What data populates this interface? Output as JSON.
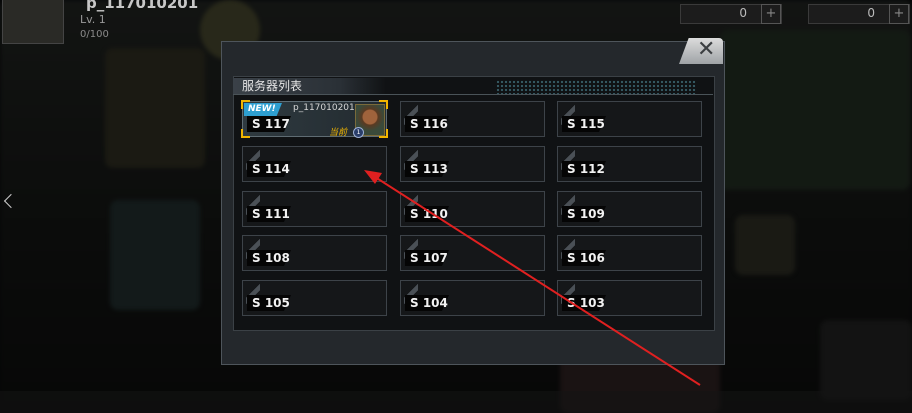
{
  "player": {
    "name": "p_117010201",
    "level_text": "Lv. 1",
    "exp_text": "0/100"
  },
  "currency": [
    {
      "icon": "gem-icon",
      "value": "0"
    },
    {
      "icon": "gold-icon",
      "value": "0"
    }
  ],
  "dialog": {
    "title": "服务器列表",
    "close_icon": "close-icon"
  },
  "current_server": {
    "label": "S 117",
    "badge": "NEW!",
    "player_name": "p_117010201",
    "current_tag": "当前",
    "rank": "1"
  },
  "servers": [
    {
      "label": "S 116"
    },
    {
      "label": "S 115"
    },
    {
      "label": "S 114"
    },
    {
      "label": "S 113"
    },
    {
      "label": "S 112"
    },
    {
      "label": "S 111"
    },
    {
      "label": "S 110"
    },
    {
      "label": "S 109"
    },
    {
      "label": "S 108"
    },
    {
      "label": "S 107"
    },
    {
      "label": "S 106"
    },
    {
      "label": "S 105"
    },
    {
      "label": "S 104"
    },
    {
      "label": "S 103"
    }
  ],
  "colors": {
    "accent_gold": "#f0b500",
    "new_badge": "#2e9fd1",
    "annotation_arrow": "#e02020"
  }
}
